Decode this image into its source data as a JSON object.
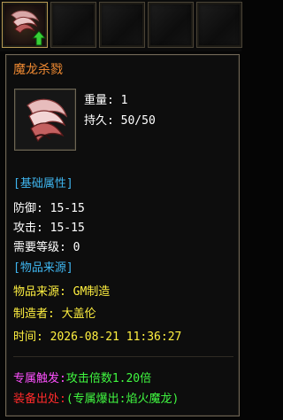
{
  "slots": [
    {
      "name": "equipped-item-slot",
      "active": true
    },
    {
      "name": "empty-slot"
    },
    {
      "name": "empty-slot"
    },
    {
      "name": "empty-slot"
    },
    {
      "name": "empty-slot"
    }
  ],
  "item": {
    "name": "魔龙杀戮",
    "weight": "重量: 1",
    "durability": "持久: 50/50"
  },
  "sections": {
    "base": "[基础属性]",
    "defense": "防御: 15-15",
    "attack": "攻击: 15-15",
    "level": "需要等级: 0",
    "source": "[物品来源]",
    "origin": "物品来源: GM制造",
    "maker": "制造者: 大盖伦",
    "time": "时间: 2026-08-21 11:36:27"
  },
  "footer": {
    "trigger_label": "专属触发:",
    "trigger_value": "攻击倍数1.20倍",
    "drop_label": "装备出处:",
    "drop_value": "(专属爆出:焰火魔龙)"
  },
  "colors": {
    "name": "#f08a32",
    "section": "#3fb6f0",
    "origin": "#fff040",
    "trigger": "#ff50ff",
    "drop": "#ff2a2a",
    "value": "#40f840"
  }
}
